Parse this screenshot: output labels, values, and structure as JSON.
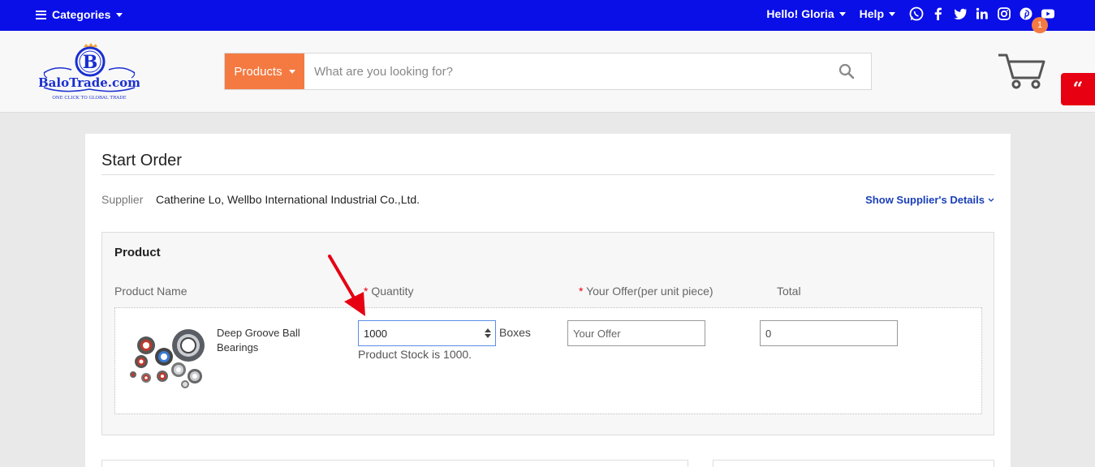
{
  "topbar": {
    "categories_label": "Categories",
    "greeting": "Hello! Gloria",
    "help_label": "Help",
    "social_icons": [
      "whatsapp-icon",
      "facebook-icon",
      "twitter-icon",
      "linkedin-icon",
      "instagram-icon",
      "pinterest-icon",
      "youtube-icon"
    ]
  },
  "header": {
    "logo_text": "BaloTrade.com",
    "logo_letter": "B",
    "logo_tagline": "ONE CLICK TO GLOBAL TRADE",
    "search_scope": "Products",
    "search_placeholder": "What are you looking for?",
    "cart_count": "1",
    "quote_icon": "“"
  },
  "order": {
    "title": "Start Order",
    "supplier_label": "Supplier",
    "supplier_name": "Catherine Lo, Wellbo International Industrial Co.,Ltd.",
    "supplier_details_link": "Show Supplier's Details",
    "product_section_title": "Product",
    "columns": {
      "product_name": "Product Name",
      "quantity": "Quantity",
      "offer": "Your Offer(per unit piece)",
      "total": "Total",
      "required_mark": "*"
    },
    "item": {
      "name": "Deep Groove Ball Bearings",
      "quantity": "1000",
      "unit": "Boxes",
      "stock_note": "Product Stock is 1000.",
      "offer_placeholder": "Your Offer",
      "total": "0"
    }
  },
  "colors": {
    "topbar": "#0a0fe8",
    "accent_orange": "#f47a41",
    "required_red": "#e60012",
    "link_blue": "#1a3fb8"
  }
}
